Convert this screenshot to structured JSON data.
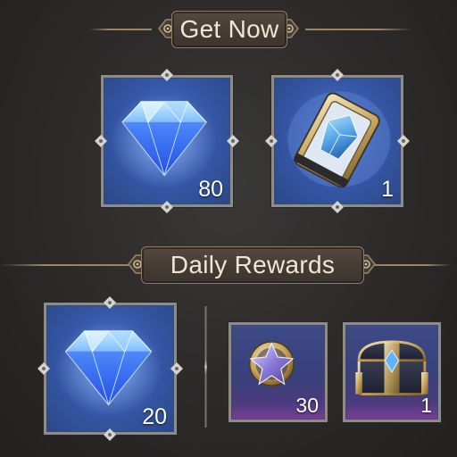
{
  "sections": {
    "get_now": {
      "title": "Get Now",
      "items": [
        {
          "icon": "diamond-icon",
          "count": "80"
        },
        {
          "icon": "crystal-emblem-icon",
          "count": "1"
        }
      ]
    },
    "daily_rewards": {
      "title": "Daily Rewards",
      "items": [
        {
          "icon": "diamond-icon",
          "count": "20"
        },
        {
          "icon": "star-medal-icon",
          "count": "30"
        },
        {
          "icon": "treasure-chest-icon",
          "count": "1"
        }
      ]
    }
  },
  "colors": {
    "frame": "#8f8b86",
    "tile_blue": "#3556a5",
    "tile_purple": "#39407a",
    "banner_text": "#f1e6d4",
    "gold": "#c8a45c"
  }
}
